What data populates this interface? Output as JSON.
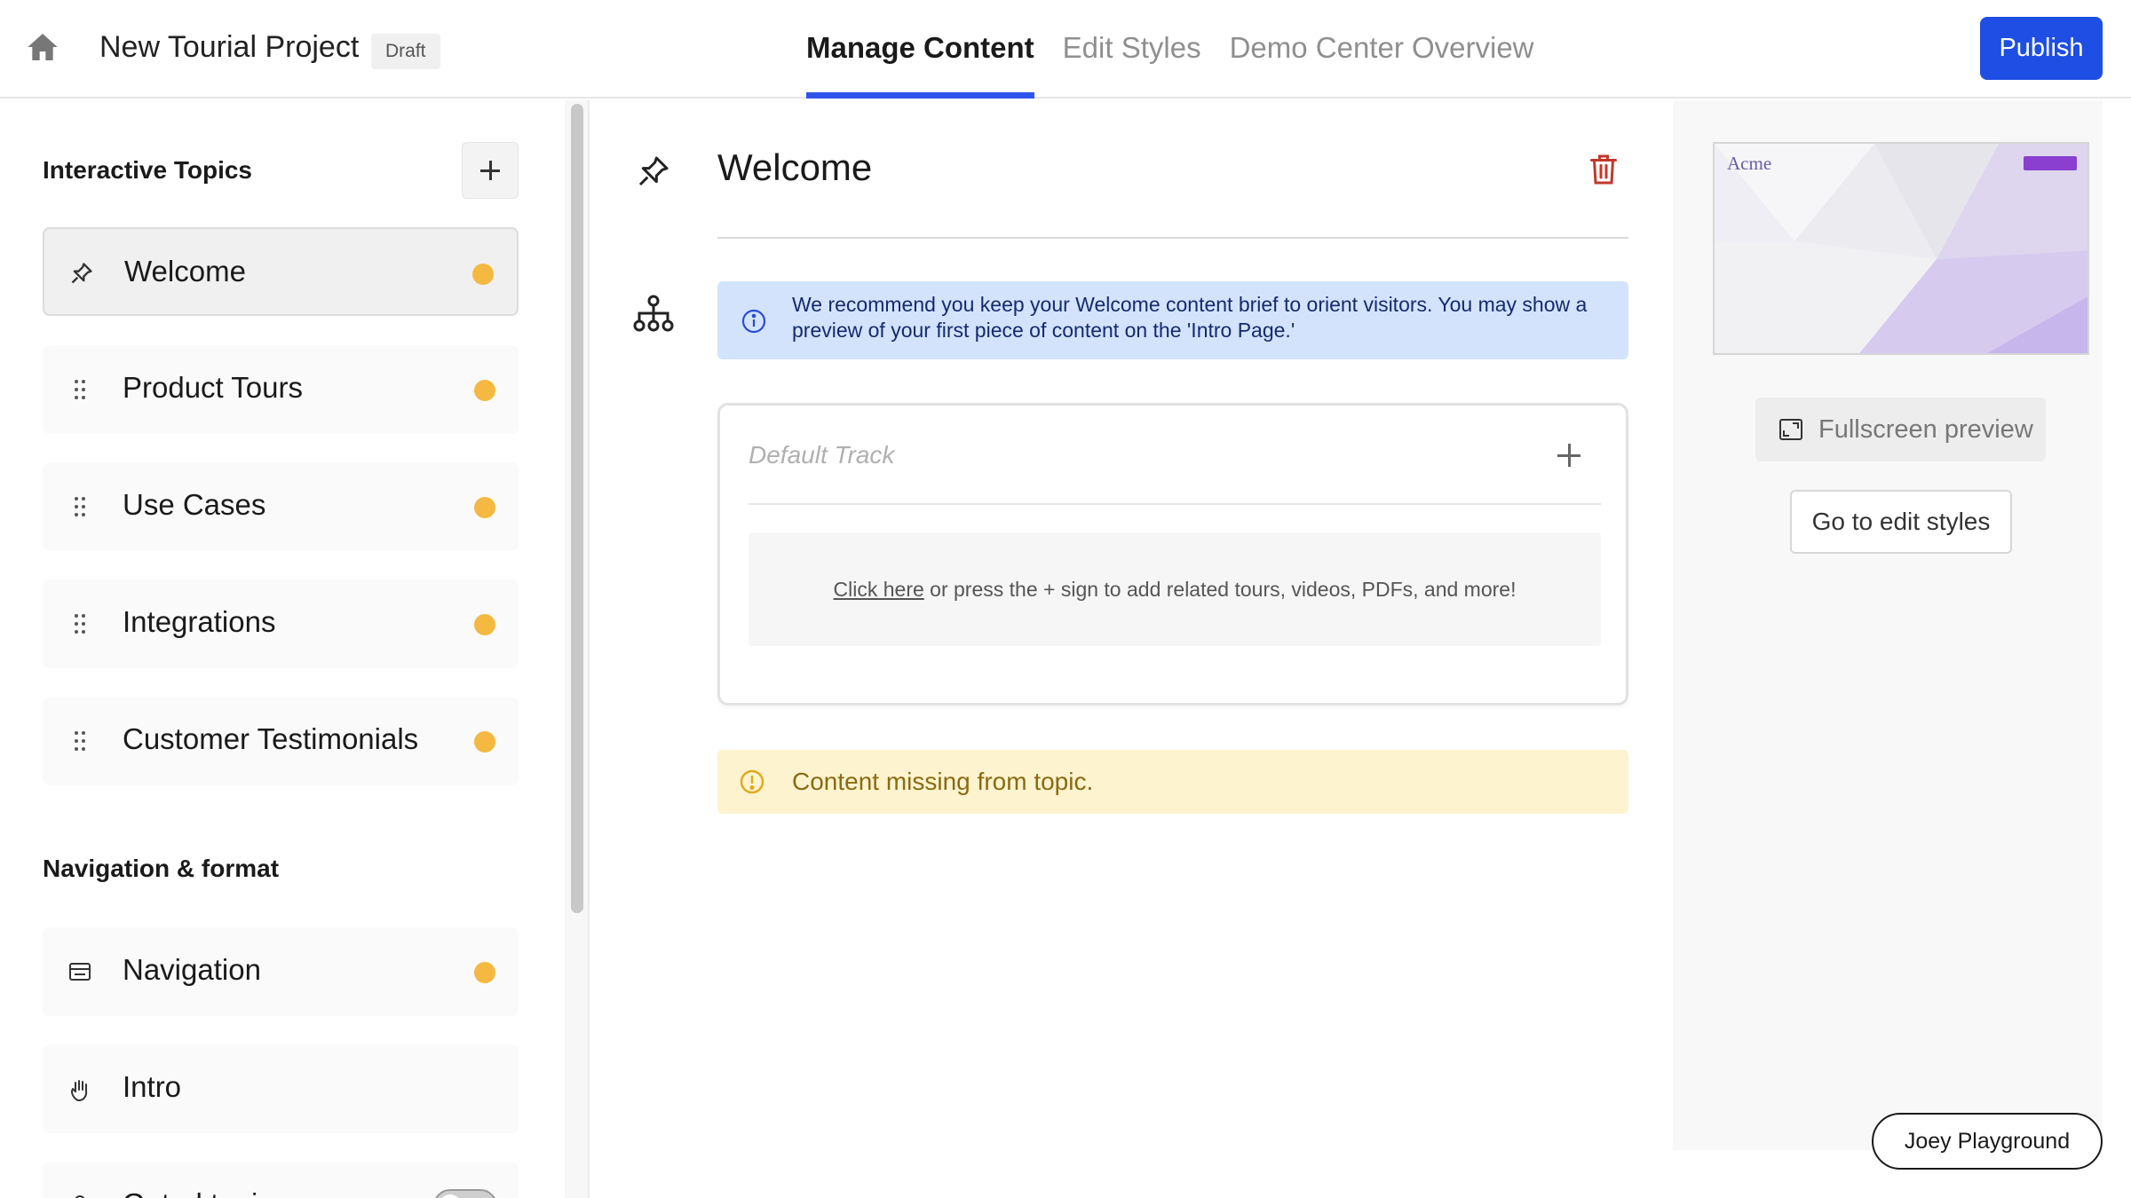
{
  "header": {
    "project_title": "New Tourial Project",
    "draft_badge": "Draft",
    "tabs": [
      {
        "label": "Manage Content",
        "active": true
      },
      {
        "label": "Edit Styles",
        "active": false
      },
      {
        "label": "Demo Center Overview",
        "active": false
      }
    ],
    "publish_label": "Publish"
  },
  "sidebar": {
    "interactive_topics_title": "Interactive Topics",
    "topics": [
      {
        "label": "Welcome",
        "icon": "pin-icon",
        "status": "incomplete"
      },
      {
        "label": "Product Tours",
        "icon": "drag-handle-icon",
        "status": "incomplete"
      },
      {
        "label": "Use Cases",
        "icon": "drag-handle-icon",
        "status": "incomplete"
      },
      {
        "label": "Integrations",
        "icon": "drag-handle-icon",
        "status": "incomplete"
      },
      {
        "label": "Customer Testimonials",
        "icon": "drag-handle-icon",
        "status": "incomplete"
      }
    ],
    "nav_format_title": "Navigation & format",
    "format_items": [
      {
        "label": "Navigation",
        "icon": "browser-window-icon",
        "status": "incomplete"
      },
      {
        "label": "Intro",
        "icon": "waving-hand-icon"
      },
      {
        "label": "Gated topics",
        "icon": "lock-icon",
        "toggle": "off"
      }
    ]
  },
  "main": {
    "topic_title": "Welcome",
    "info_text": "We recommend you keep your Welcome content brief to orient visitors. You may show a preview of your first piece of content on the 'Intro Page.'",
    "track": {
      "title_placeholder": "Default Track",
      "empty_link": "Click here",
      "empty_text": " or press the + sign to add related tours, videos, PDFs, and more!"
    },
    "warning_text": "Content missing from topic."
  },
  "preview": {
    "thumbnail_logo": "Acme",
    "fullscreen_label": "Fullscreen preview",
    "edit_styles_label": "Go to edit styles"
  },
  "footer": {
    "workspace_label": "Joey Playground"
  },
  "colors": {
    "accent": "#1e4ee3",
    "status_dot": "#f5b841",
    "info_bg": "#d3e3fb",
    "warning_bg": "#fdf3cf",
    "delete": "#c0392b"
  }
}
